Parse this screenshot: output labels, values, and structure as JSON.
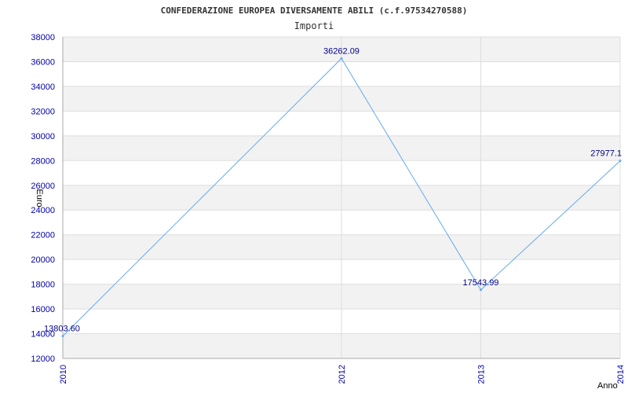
{
  "chart_data": {
    "type": "line",
    "title": "CONFEDERAZIONE EUROPEA DIVERSAMENTE ABILI (c.f.97534270588)",
    "subtitle": "Importi",
    "xlabel": "Anno",
    "ylabel": "Euro",
    "x": [
      "2010",
      "2012",
      "2013",
      "2014"
    ],
    "series": [
      {
        "values": [
          13803.6,
          36262.09,
          17543.99,
          27977.1
        ]
      }
    ],
    "data_labels": [
      "13803.60",
      "36262.09",
      "17543.99",
      "27977.1"
    ],
    "ylim": [
      12000,
      38000
    ],
    "yticks": [
      "12000",
      "14000",
      "16000",
      "18000",
      "20000",
      "22000",
      "24000",
      "26000",
      "28000",
      "30000",
      "32000",
      "34000",
      "36000",
      "38000"
    ],
    "grid": true,
    "legend": "none",
    "colors": {
      "line": "#66aaee",
      "band": "#f2f2f2",
      "tick_text": "#0000aa",
      "label_text": "#000088",
      "gridline": "#dddddd"
    }
  }
}
